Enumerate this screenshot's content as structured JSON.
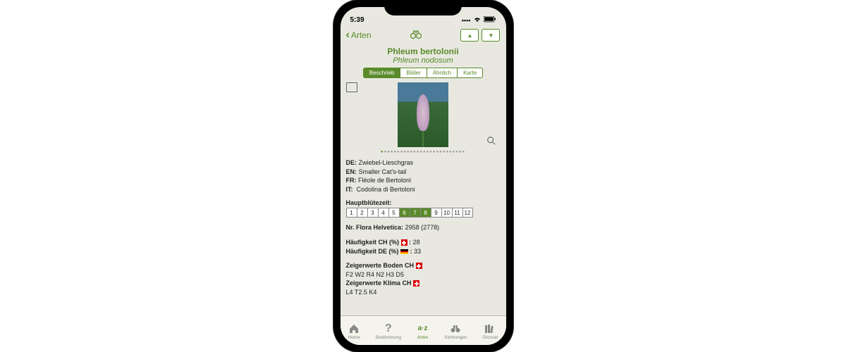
{
  "status": {
    "time": "5:39"
  },
  "nav": {
    "back_label": "Arten",
    "up_glyph": "▲",
    "down_glyph": "▼"
  },
  "species": {
    "name_main": "Phleum bertolonii",
    "name_sub": "Phleum nodosum"
  },
  "tabs": [
    {
      "label": "Beschrieb",
      "active": true
    },
    {
      "label": "Bilder",
      "active": false
    },
    {
      "label": "Ähnlich",
      "active": false
    },
    {
      "label": "Karte",
      "active": false
    }
  ],
  "image_dots_total": 26,
  "image_dots_active": 0,
  "common_names": {
    "de_label": "DE:",
    "de_value": "Zwiebel-Lieschgras",
    "en_label": "EN:",
    "en_value": "Smaller Cat's-tail",
    "fr_label": "FR:",
    "fr_value": "Fléole de Bertoloni",
    "it_label": "IT:",
    "it_value": "Codolina di Bertoloni"
  },
  "bloom": {
    "label": "Hauptblütezeit:",
    "months": [
      1,
      2,
      3,
      4,
      5,
      6,
      7,
      8,
      9,
      10,
      11,
      12
    ],
    "active": [
      6,
      7,
      8
    ]
  },
  "flora_helvetica": {
    "label": "Nr. Flora Helvetica:",
    "value": "2958 (2778)"
  },
  "frequency": {
    "ch_label": "Häufigkeit CH (%)",
    "ch_value": "28",
    "de_label": "Häufigkeit DE (%)",
    "de_value": "33"
  },
  "indicators": {
    "soil_label": "Zeigerwerte Boden CH",
    "soil_value": "F2 W2 R4 N2 H3 D5",
    "climate_label": "Zeigerwerte Klima CH",
    "climate_value": "L4 T2.5 K4"
  },
  "tabbar": [
    {
      "label": "Home",
      "icon": "home"
    },
    {
      "label": "Bestimmung",
      "icon": "question"
    },
    {
      "label": "Arten",
      "icon": "az",
      "active": true
    },
    {
      "label": "Sichtungen",
      "icon": "binoculars"
    },
    {
      "label": "Glossar",
      "icon": "books"
    }
  ]
}
